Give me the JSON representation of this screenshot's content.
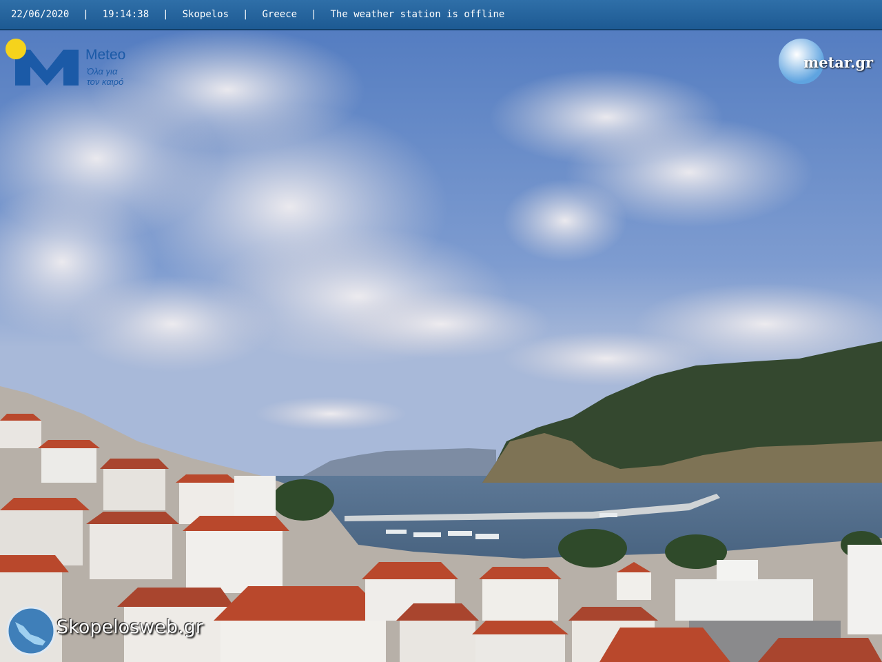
{
  "header": {
    "date": "22/06/2020",
    "time": "19:14:38",
    "place": "Skopelos",
    "country": "Greece",
    "status": "The weather station is offline",
    "separator": "|"
  },
  "logos": {
    "meteo_name": "Meteo",
    "meteo_tagline_1": "Όλα για",
    "meteo_tagline_2": "τον καιρό",
    "metar_name": "metar.gr",
    "skopelos_name": "Skopelosweb.gr"
  },
  "colors": {
    "topbar": "#1d5a93",
    "sky_top": "#4f79bf",
    "sky_bottom": "#9fb3d8",
    "sea": "#3a5878",
    "mountain": "#34482f",
    "roof": "#b9482c",
    "meteo_blue": "#1b5aa7",
    "meteo_sun": "#f5d31c"
  }
}
